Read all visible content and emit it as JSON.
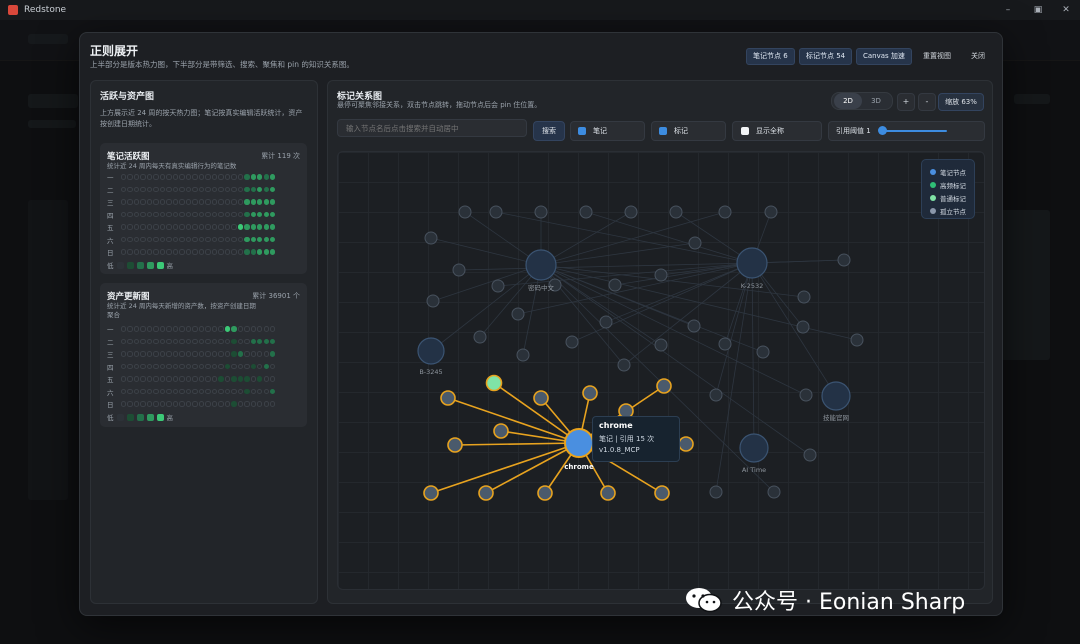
{
  "app": {
    "title": "Redstone"
  },
  "window_controls": {
    "minimize": "–",
    "maximize": "▣",
    "close": "✕"
  },
  "modal": {
    "title": "正则展开",
    "subtitle": "上半部分是版本热力图，下半部分是带筛选、搜索、聚焦和 pin 的知识关系图。",
    "header_buttons": [
      {
        "label": "笔记节点 6"
      },
      {
        "label": "标记节点 54"
      },
      {
        "label": "Canvas 加速"
      },
      {
        "label": "重置视图"
      },
      {
        "label": "关闭"
      }
    ]
  },
  "activity_panel": {
    "title": "活跃与资产图",
    "desc": "上方展示近 24 周的按天热力图；笔记按真实编辑活跃统计，资产按创建日期统计。",
    "notes_card": {
      "title": "笔记活跃图",
      "count": "累计 119 次",
      "sub": "统计近 24 周内每天有真实编辑行为的笔记数",
      "days": [
        "一",
        "二",
        "三",
        "四",
        "五",
        "六",
        "日"
      ],
      "legend_low": "低",
      "legend_high": "高",
      "levels": [
        [
          0,
          0,
          0,
          0,
          0,
          0,
          0,
          0,
          0,
          0,
          0,
          0,
          0,
          0,
          0,
          0,
          0,
          0,
          0,
          2,
          3,
          3,
          2,
          3
        ],
        [
          0,
          0,
          0,
          0,
          0,
          0,
          0,
          0,
          0,
          0,
          0,
          0,
          0,
          0,
          0,
          0,
          0,
          0,
          0,
          2,
          2,
          3,
          2,
          3
        ],
        [
          0,
          0,
          0,
          0,
          0,
          0,
          0,
          0,
          0,
          0,
          0,
          0,
          0,
          0,
          0,
          0,
          0,
          0,
          0,
          3,
          3,
          3,
          3,
          3
        ],
        [
          0,
          0,
          0,
          0,
          0,
          0,
          0,
          0,
          0,
          0,
          0,
          0,
          0,
          0,
          0,
          0,
          0,
          0,
          0,
          2,
          3,
          3,
          3,
          3
        ],
        [
          0,
          0,
          0,
          0,
          0,
          0,
          0,
          0,
          0,
          0,
          0,
          0,
          0,
          0,
          0,
          0,
          0,
          0,
          4,
          3,
          3,
          3,
          3,
          3
        ],
        [
          0,
          0,
          0,
          0,
          0,
          0,
          0,
          0,
          0,
          0,
          0,
          0,
          0,
          0,
          0,
          0,
          0,
          0,
          0,
          3,
          3,
          3,
          3,
          3
        ],
        [
          0,
          0,
          0,
          0,
          0,
          0,
          0,
          0,
          0,
          0,
          0,
          0,
          0,
          0,
          0,
          0,
          0,
          0,
          0,
          2,
          2,
          3,
          3,
          3
        ]
      ]
    },
    "assets_card": {
      "title": "资产更新图",
      "count": "累计 36901 个",
      "sub": "统计近 24 周内每天新增的资产数，按资产创建日期聚合",
      "days": [
        "一",
        "二",
        "三",
        "四",
        "五",
        "六",
        "日"
      ],
      "legend_low": "低",
      "legend_high": "高",
      "levels": [
        [
          0,
          0,
          0,
          0,
          0,
          0,
          0,
          0,
          0,
          0,
          0,
          0,
          0,
          0,
          0,
          0,
          4,
          3,
          0,
          0,
          0,
          0,
          0,
          0
        ],
        [
          0,
          0,
          0,
          0,
          0,
          0,
          0,
          0,
          0,
          0,
          0,
          0,
          0,
          0,
          0,
          0,
          0,
          1,
          0,
          0,
          2,
          2,
          2,
          2
        ],
        [
          0,
          0,
          0,
          0,
          0,
          0,
          0,
          0,
          0,
          0,
          0,
          0,
          0,
          0,
          0,
          0,
          0,
          1,
          2,
          0,
          0,
          0,
          0,
          2
        ],
        [
          0,
          0,
          0,
          0,
          0,
          0,
          0,
          0,
          0,
          0,
          0,
          0,
          0,
          0,
          0,
          0,
          1,
          0,
          0,
          0,
          1,
          0,
          2,
          0
        ],
        [
          0,
          0,
          0,
          0,
          0,
          0,
          0,
          0,
          0,
          0,
          0,
          0,
          0,
          0,
          0,
          1,
          0,
          1,
          1,
          1,
          0,
          1,
          0,
          0
        ],
        [
          0,
          0,
          0,
          0,
          0,
          0,
          0,
          0,
          0,
          0,
          0,
          0,
          0,
          0,
          0,
          0,
          0,
          0,
          0,
          1,
          0,
          0,
          0,
          2
        ],
        [
          0,
          0,
          0,
          0,
          0,
          0,
          0,
          0,
          0,
          0,
          0,
          0,
          0,
          0,
          0,
          0,
          0,
          1,
          0,
          0,
          0,
          0,
          0,
          0
        ]
      ]
    }
  },
  "graph_panel": {
    "title": "标记关系图",
    "desc": "悬停可聚焦邻接关系，双击节点跳转，拖动节点后会 pin 住位置。",
    "mode_2d": "2D",
    "mode_3d": "3D",
    "zoom_in": "+",
    "zoom_out": "-",
    "zoom_label": "缩放 63%",
    "search_placeholder": "输入节点名后点击搜索并自动居中",
    "search_button": "搜索",
    "filter_notes": "笔记",
    "filter_tags": "标记",
    "filter_fullname": "显示全称",
    "threshold_label": "引用阈值 1",
    "legend": [
      {
        "label": "笔记节点",
        "color": "#4a8fe0"
      },
      {
        "label": "高频标记",
        "color": "#2fbf77"
      },
      {
        "label": "普通标记",
        "color": "#7fe3a6"
      },
      {
        "label": "孤立节点",
        "color": "#8a97aa"
      }
    ],
    "node_labels": {
      "n1": "密码中文",
      "n2": "K-2532",
      "n3": "B-3245",
      "n4": "AI Time",
      "n5": "技能官网",
      "center": "chrome"
    },
    "tooltip": {
      "name": "chrome",
      "type_line": "笔记 | 引用 15 次",
      "extra": "v1.0.8_MCP"
    }
  },
  "watermark": {
    "text": "公众号 · Eonian Sharp"
  }
}
